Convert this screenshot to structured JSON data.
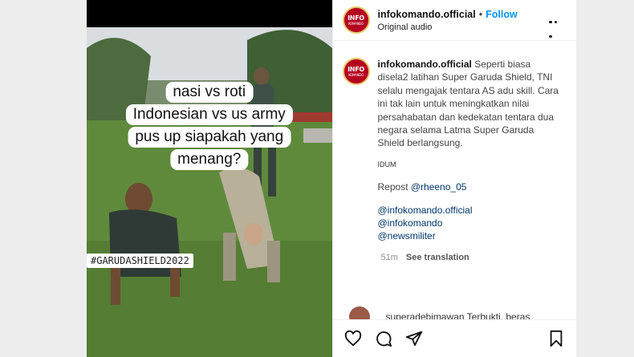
{
  "media": {
    "overlay_lines": [
      "nasi vs roti",
      "Indonesian vs us army",
      "pus up siapakah yang",
      "menang?"
    ],
    "hashtag": "#GARUDASHIELD2022"
  },
  "header": {
    "username": "infokomando.official",
    "separator": "•",
    "follow_label": "Follow",
    "audio": "Original audio"
  },
  "avatar": {
    "logo_top": "INFO",
    "logo_bottom": "KOMANDO"
  },
  "caption": {
    "username": "infokomando.official",
    "text": "Seperti biasa disela2 latihan Super Garuda Shield, TNI selalu mengajak tentara AS adu skill. Cara ini tak lain untuk meningkatkan nilai persahabatan dan kedekatan tentara dua negara selama Latma Super Garuda Shield berlangsung.",
    "small": "IDUM",
    "repost_prefix": "Repost ",
    "repost_mention": "@rheeno_05",
    "mentions": [
      "@infokomando.official",
      "@infokomando",
      "@newsmiliter"
    ]
  },
  "meta": {
    "time": "51m",
    "see_translation": "See translation"
  },
  "comment_peek": {
    "text": "superadebimawan Terbukti, beras"
  },
  "colors": {
    "follow": "#0095f6",
    "mention": "#00376b",
    "avatar_bg": "#b5001f"
  },
  "icons": [
    "heart-icon",
    "comment-icon",
    "share-icon",
    "bookmark-icon",
    "more-icon"
  ]
}
